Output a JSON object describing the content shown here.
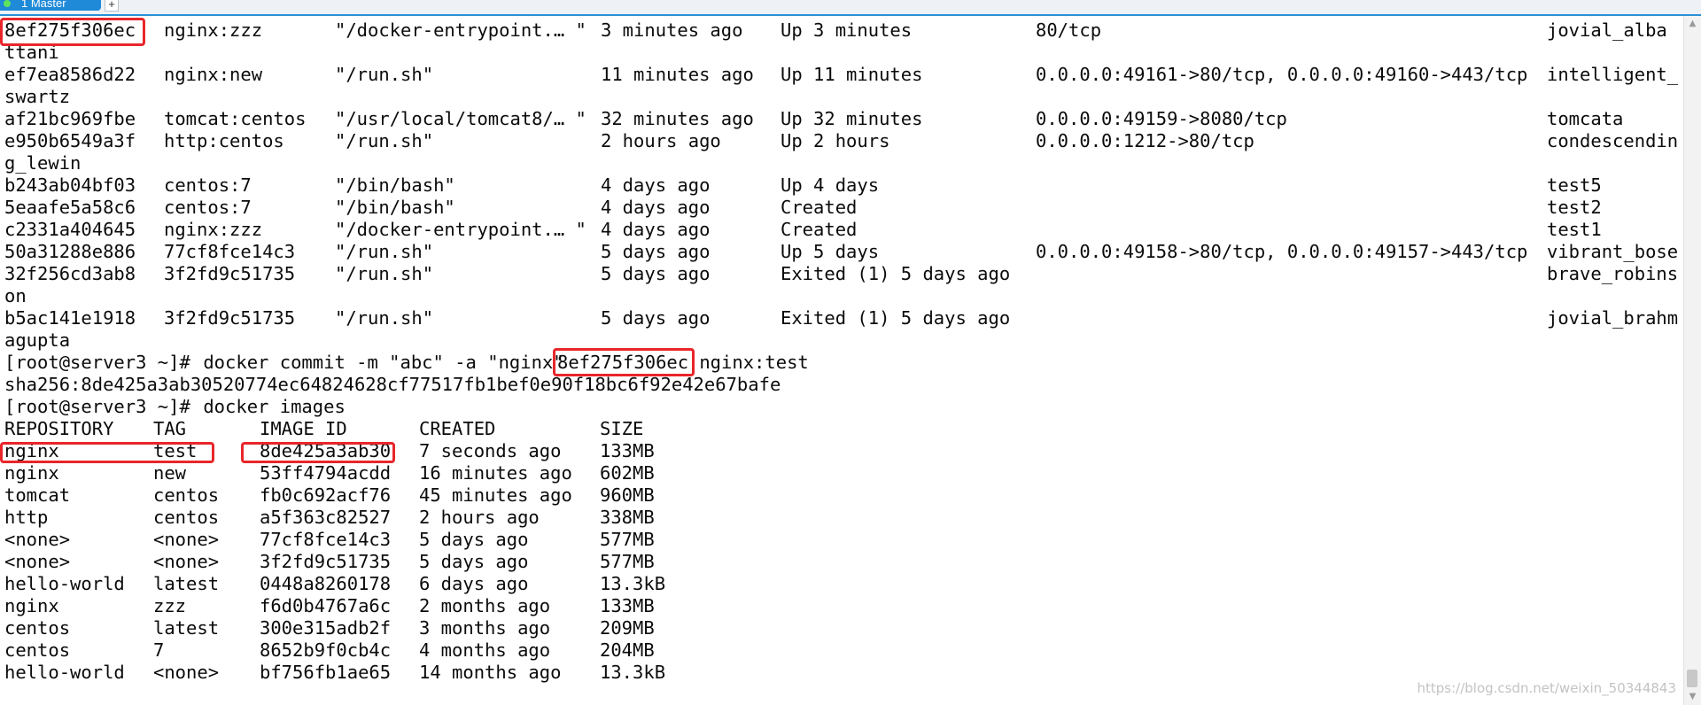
{
  "tabs": [
    {
      "label": "1 Master"
    }
  ],
  "new_tab_label": "+",
  "terminal": {
    "ps_rows": [
      {
        "id": "8ef275f306ec",
        "image": "nginx:zzz",
        "command": "\"/docker-entrypoint.… \"",
        "created": "3 minutes ago",
        "status": "Up 3 minutes",
        "ports": "80/tcp",
        "names": "jovial_alba",
        "wrap": "ttani"
      },
      {
        "id": "ef7ea8586d22",
        "image": "nginx:new",
        "command": "\"/run.sh\"",
        "created": "11 minutes ago",
        "status": "Up 11 minutes",
        "ports": "0.0.0.0:49161->80/tcp, 0.0.0.0:49160->443/tcp",
        "names": "intelligent_",
        "wrap": "swartz"
      },
      {
        "id": "af21bc969fbe",
        "image": "tomcat:centos",
        "command": "\"/usr/local/tomcat8/… \"",
        "created": "32 minutes ago",
        "status": "Up 32 minutes",
        "ports": "0.0.0.0:49159->8080/tcp",
        "names": "tomcata",
        "wrap": ""
      },
      {
        "id": "e950b6549a3f",
        "image": "http:centos",
        "command": "\"/run.sh\"",
        "created": "2 hours ago",
        "status": "Up 2 hours",
        "ports": "0.0.0.0:1212->80/tcp",
        "names": "condescendin",
        "wrap": "g_lewin"
      },
      {
        "id": "b243ab04bf03",
        "image": "centos:7",
        "command": "\"/bin/bash\"",
        "created": "4 days ago",
        "status": "Up 4 days",
        "ports": "",
        "names": "test5",
        "wrap": ""
      },
      {
        "id": "5eaafe5a58c6",
        "image": "centos:7",
        "command": "\"/bin/bash\"",
        "created": "4 days ago",
        "status": "Created",
        "ports": "",
        "names": "test2",
        "wrap": ""
      },
      {
        "id": "c2331a404645",
        "image": "nginx:zzz",
        "command": "\"/docker-entrypoint.… \"",
        "created": "4 days ago",
        "status": "Created",
        "ports": "",
        "names": "test1",
        "wrap": ""
      },
      {
        "id": "50a31288e886",
        "image": "77cf8fce14c3",
        "command": "\"/run.sh\"",
        "created": "5 days ago",
        "status": "Up 5 days",
        "ports": "0.0.0.0:49158->80/tcp, 0.0.0.0:49157->443/tcp",
        "names": "vibrant_bose",
        "wrap": ""
      },
      {
        "id": "32f256cd3ab8",
        "image": "3f2fd9c51735",
        "command": "\"/run.sh\"",
        "created": "5 days ago",
        "status": "Exited (1) 5 days ago",
        "ports": "",
        "names": "brave_robins",
        "wrap": "on"
      },
      {
        "id": "b5ac141e1918",
        "image": "3f2fd9c51735",
        "command": "\"/run.sh\"",
        "created": "5 days ago",
        "status": "Exited (1) 5 days ago",
        "ports": "",
        "names": "jovial_brahm",
        "wrap": "agupta"
      }
    ],
    "commit": {
      "prompt": "[root@server3 ~]#",
      "command_before": " docker commit -m \"abc\" -a \"nginx\" ",
      "container_id": "8ef275f306ec",
      "command_after": " nginx:test",
      "output": "sha256:8de425a3ab30520774ec64824628cf77517fb1bef0e90f18bc6f92e42e67bafe"
    },
    "images_cmd": {
      "prompt": "[root@server3 ~]#",
      "command": " docker images"
    },
    "images_header": [
      "REPOSITORY",
      "TAG",
      "IMAGE ID",
      "CREATED",
      "SIZE"
    ],
    "images_rows": [
      [
        "nginx",
        "test",
        "8de425a3ab30",
        "7 seconds ago",
        "133MB"
      ],
      [
        "nginx",
        "new",
        "53ff4794acdd",
        "16 minutes ago",
        "602MB"
      ],
      [
        "tomcat",
        "centos",
        "fb0c692acf76",
        "45 minutes ago",
        "960MB"
      ],
      [
        "http",
        "centos",
        "a5f363c82527",
        "2 hours ago",
        "338MB"
      ],
      [
        "<none>",
        "<none>",
        "77cf8fce14c3",
        "5 days ago",
        "577MB"
      ],
      [
        "<none>",
        "<none>",
        "3f2fd9c51735",
        "5 days ago",
        "577MB"
      ],
      [
        "hello-world",
        "latest",
        "0448a8260178",
        "6 days ago",
        "13.3kB"
      ],
      [
        "nginx",
        "zzz",
        "f6d0b4767a6c",
        "2 months ago",
        "133MB"
      ],
      [
        "centos",
        "latest",
        "300e315adb2f",
        "3 months ago",
        "209MB"
      ],
      [
        "centos",
        "7",
        "8652b9f0cb4c",
        "4 months ago",
        "204MB"
      ],
      [
        "hello-world",
        "<none>",
        "bf756fb1ae65",
        "14 months ago",
        "13.3kB"
      ]
    ]
  },
  "watermark": "https://blog.csdn.net/weixin_50344843",
  "colors": {
    "text": "#0b0b0b",
    "highlight": "#e8262a",
    "tab": "#1f8ad8"
  }
}
